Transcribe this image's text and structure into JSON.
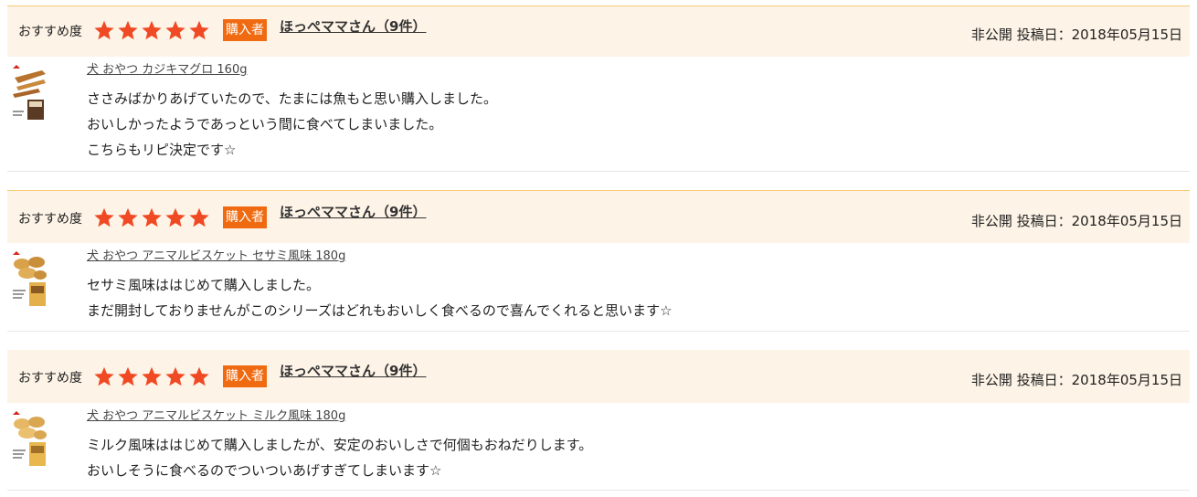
{
  "reviews": [
    {
      "rec_label": "おすすめ度",
      "rating": 5,
      "buyer_badge": "購入者",
      "reviewer": "ほっぺママさん（9件）",
      "post_meta": "非公開 投稿日：2018年05月15日",
      "product": "犬 おやつ カジキマグロ 160g",
      "comment": [
        "ささみばかりあげていたので、たまには魚もと思い購入しました。",
        "おいしかったようであっという間に食べてしまいました。",
        "こちらもリピ決定です☆"
      ],
      "thumb_icon": "kajiki-maguro-product-icon"
    },
    {
      "rec_label": "おすすめ度",
      "rating": 5,
      "buyer_badge": "購入者",
      "reviewer": "ほっぺママさん（9件）",
      "post_meta": "非公開 投稿日：2018年05月15日",
      "product": "犬 おやつ アニマルビスケット セサミ風味 180g",
      "comment": [
        "セサミ風味ははじめて購入しました。",
        "まだ開封しておりませんがこのシリーズはどれもおいしく食べるので喜んでくれると思います☆"
      ],
      "thumb_icon": "animal-biscuit-sesame-product-icon"
    },
    {
      "rec_label": "おすすめ度",
      "rating": 5,
      "buyer_badge": "購入者",
      "reviewer": "ほっぺママさん（9件）",
      "post_meta": "非公開 投稿日：2018年05月15日",
      "product": "犬 おやつ アニマルビスケット ミルク風味 180g",
      "comment": [
        "ミルク風味ははじめて購入しましたが、安定のおいしさで何個もおねだりします。",
        "おいしそうに食べるのでついついあげすぎてしまいます☆"
      ],
      "thumb_icon": "animal-biscuit-milk-product-icon"
    }
  ],
  "colors": {
    "header_bg": "#fdf3e6",
    "header_border": "#f7c97a",
    "star": "#f04a24",
    "badge": "#ef6a10"
  }
}
